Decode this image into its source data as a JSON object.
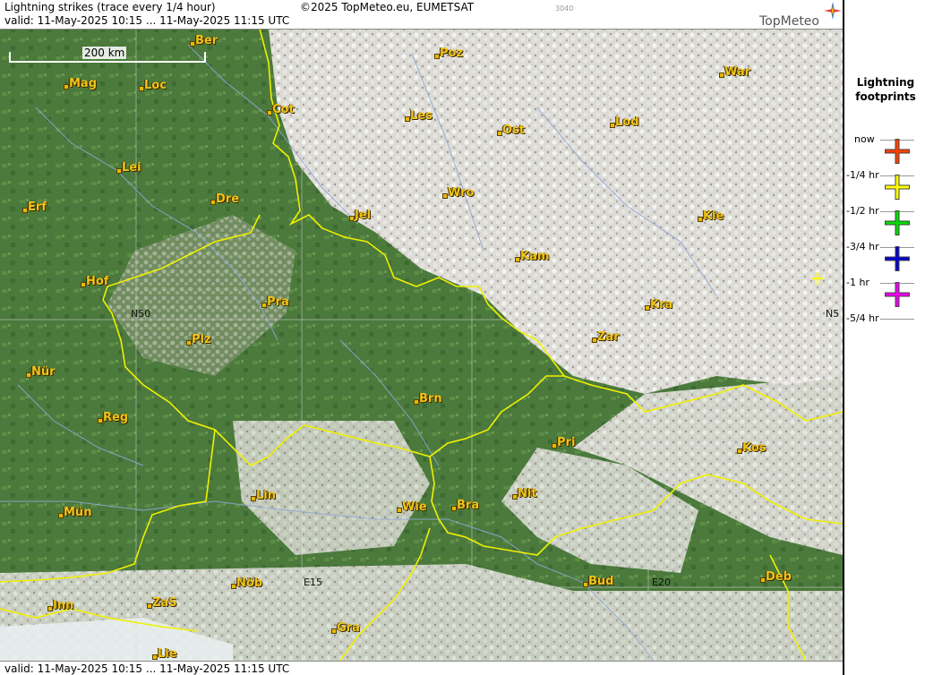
{
  "header": {
    "title": "Lightning strikes (trace every 1/4 hour)",
    "copyright": "©2025 TopMeteo.eu, EUMETSAT",
    "code": "3040",
    "valid": "valid:  11-May-2025 10:15 ... 11-May-2025 11:15 UTC",
    "logo": "TopMeteo"
  },
  "footer": {
    "valid": "valid:  11-May-2025 10:15 ... 11-May-2025 11:15 UTC"
  },
  "map": {
    "scale_label": "200 km",
    "grid_labels": [
      "N50",
      "N5",
      "E15",
      "E20"
    ],
    "cities": [
      "Ber",
      "Poz",
      "War",
      "Mag",
      "Loc",
      "Cot",
      "Les",
      "Lod",
      "Ost",
      "Lei",
      "Wro",
      "Kie",
      "Erf",
      "Dre",
      "Jel",
      "Kam",
      "Hof",
      "Pra",
      "Kra",
      "Plz",
      "Zar",
      "Nür",
      "Brn",
      "Reg",
      "Pri",
      "Kos",
      "Lin",
      "Nit",
      "Wie",
      "Bra",
      "Mün",
      "Deb",
      "Nöb",
      "Bud",
      "Inn",
      "ZaS",
      "Gra",
      "Lie"
    ]
  },
  "legend": {
    "title_line1": "Lightning",
    "title_line2": "footprints",
    "items": [
      {
        "label": "now",
        "color": ""
      },
      {
        "label": "-1/4 hr",
        "color": "#ff4000"
      },
      {
        "label": "-1/2 hr",
        "color": "#ffff00"
      },
      {
        "label": "-3/4 hr",
        "color": "#00dd00"
      },
      {
        "label": "-1 hr",
        "color": "#0000cc"
      },
      {
        "label": "-5/4 hr",
        "color": "#ee00ee"
      }
    ]
  },
  "colors": {
    "city": "#f0c419",
    "border": "#f0f000",
    "river": "#8fa6d8",
    "land": "#4c7a3e",
    "cloud": "#ece6e4"
  }
}
